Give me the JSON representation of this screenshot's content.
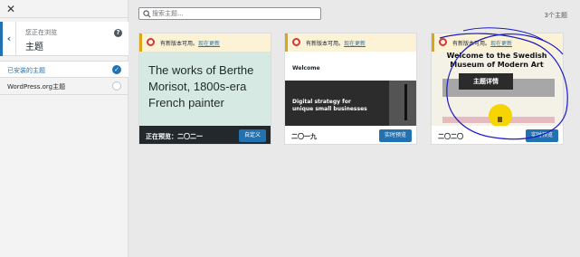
{
  "sidebar": {
    "close_glyph": "✕",
    "back_glyph": "‹",
    "subtitle": "您正在浏览",
    "title": "主题",
    "help_glyph": "?",
    "items": [
      {
        "label": "已安装的主题",
        "selected": true
      },
      {
        "label": "WordPress.org主题",
        "selected": false
      }
    ]
  },
  "search": {
    "placeholder": "搜索主题..."
  },
  "theme_count": "3个主题",
  "update_notice": {
    "text": "有新版本可用。",
    "link": "现在更新"
  },
  "themes": [
    {
      "name": "正在预览：二〇二一",
      "button": "自定义",
      "preview_text": "The works of Berthe Morisot, 1800s-era French painter"
    },
    {
      "name": "二〇一九",
      "button": "实时预览",
      "preview_welcome": "Welcome",
      "preview_tagline": "Digital strategy for unique small businesses"
    },
    {
      "name": "二〇二〇",
      "button": "实时预览",
      "preview_heading": "Welcome to the Swedish Museum of Modern Art",
      "details_button": "主题详情"
    }
  ],
  "colors": {
    "accent": "#2271b1",
    "notice_bg": "#fcf3d7",
    "annotation": "#1a1ac8",
    "highlight": "#f6d400"
  }
}
